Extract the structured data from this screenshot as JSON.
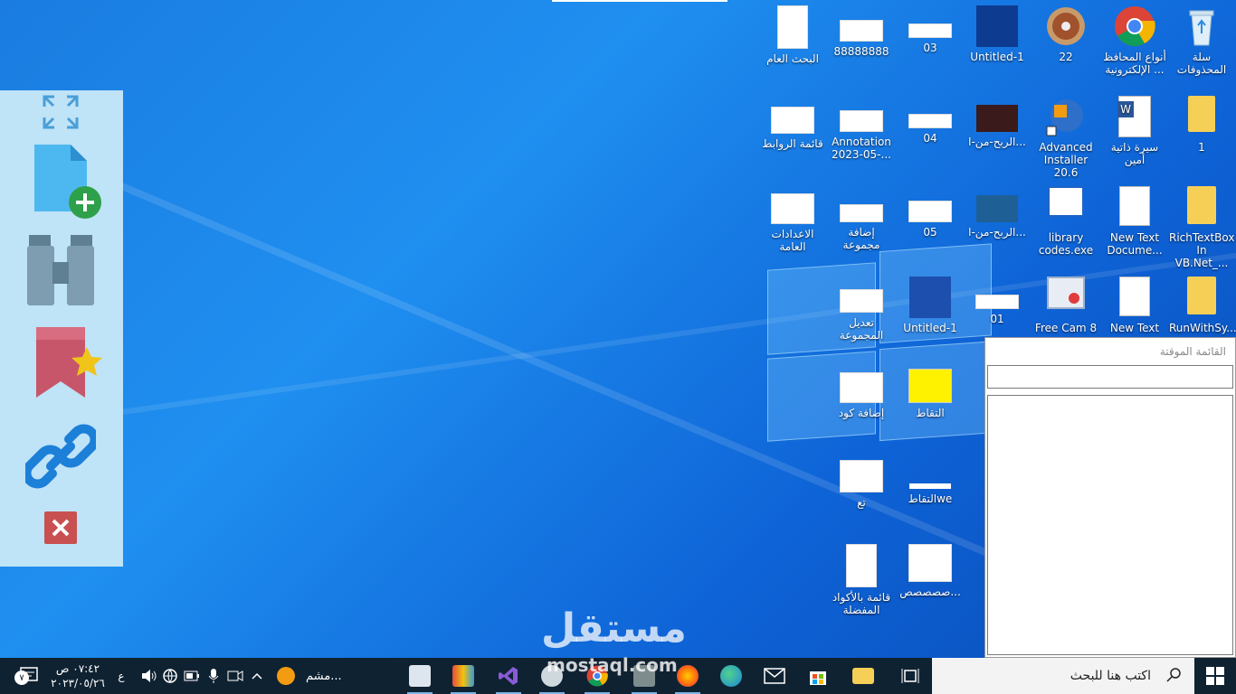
{
  "side_panel": {
    "buttons": [
      "fullscreen",
      "new-file",
      "find",
      "favorites",
      "links",
      "close"
    ]
  },
  "desktop": {
    "icons": [
      {
        "label": "سلة المحذوفات"
      },
      {
        "label": "أنواع المحافظ الإلكترونية ..."
      },
      {
        "label": "22"
      },
      {
        "label": "Untitled-1"
      },
      {
        "label": "03"
      },
      {
        "label": "88888888"
      },
      {
        "label": "البحث العام"
      },
      {
        "label": "1"
      },
      {
        "label": "سيرة ذاتية أمين"
      },
      {
        "label": "Advanced Installer 20.6"
      },
      {
        "label": "الربح-من-ا..."
      },
      {
        "label": "04"
      },
      {
        "label": "Annotation 2023-05-..."
      },
      {
        "label": "قائمة الروابط"
      },
      {
        "label": "RichTextBox In VB.Net_..."
      },
      {
        "label": "New Text Docume..."
      },
      {
        "label": "library codes.exe"
      },
      {
        "label": "الربح-من-ا..."
      },
      {
        "label": "05"
      },
      {
        "label": "إضافة مجموعة"
      },
      {
        "label": "الاعدادات العامة"
      },
      {
        "label": "RunWithSy..."
      },
      {
        "label": "New Text"
      },
      {
        "label": "Free Cam 8"
      },
      {
        "label": "01"
      },
      {
        "label": "Untitled-1"
      },
      {
        "label": "تعديل المجموعة"
      },
      {
        "label": "التقاط"
      },
      {
        "label": "إضافة كود"
      },
      {
        "label": "التقاطwe"
      },
      {
        "label": "تع"
      },
      {
        "label": "صصصصص..."
      },
      {
        "label": "قائمة بالأكواد المفضلة"
      }
    ]
  },
  "pinned_list": {
    "title": "القائمة الموقتة",
    "input_value": ""
  },
  "taskbar": {
    "search_placeholder": "اكتب هنا للبحث",
    "time": "٠٧:٤٢ ص",
    "date": "٢٠٢٣/٠٥/٢٦",
    "language": "ع",
    "notification_count": "٧",
    "running_app_label": "مشم..."
  },
  "watermark": {
    "text": "مستقل",
    "subtext": "mostaql.com"
  }
}
